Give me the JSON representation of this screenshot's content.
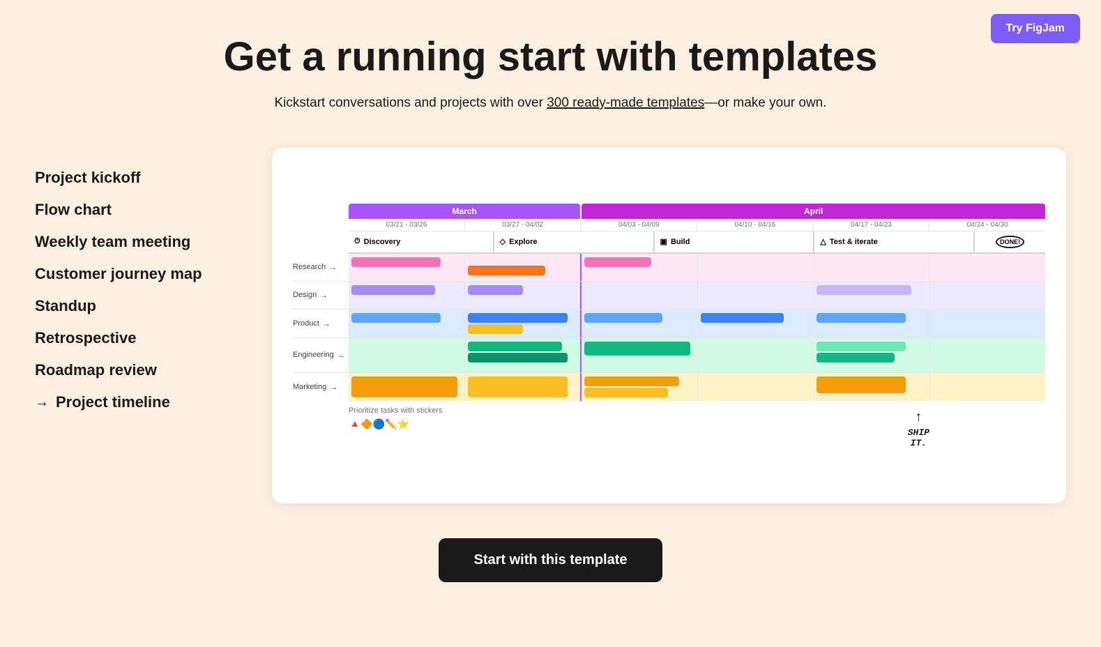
{
  "header": {
    "title": "Get a running start with templates",
    "subtitle_plain": "Kickstart conversations and projects with over ",
    "subtitle_link": "300 ready-made templates",
    "subtitle_end": "—or make your own.",
    "try_button": "Try FigJam"
  },
  "sidebar": {
    "items": [
      {
        "id": "project-kickoff",
        "label": "Project kickoff",
        "active": false,
        "arrow": false
      },
      {
        "id": "flow-chart",
        "label": "Flow chart",
        "active": false,
        "arrow": false
      },
      {
        "id": "weekly-team-meeting",
        "label": "Weekly team meeting",
        "active": false,
        "arrow": false
      },
      {
        "id": "customer-journey-map",
        "label": "Customer journey map",
        "active": false,
        "arrow": false
      },
      {
        "id": "standup",
        "label": "Standup",
        "active": false,
        "arrow": false
      },
      {
        "id": "retrospective",
        "label": "Retrospective",
        "active": false,
        "arrow": false
      },
      {
        "id": "roadmap-review",
        "label": "Roadmap review",
        "active": false,
        "arrow": false
      },
      {
        "id": "project-timeline",
        "label": "Project timeline",
        "active": true,
        "arrow": true
      }
    ]
  },
  "timeline": {
    "months": [
      {
        "label": "March",
        "color": "#a855f7"
      },
      {
        "label": "April",
        "color": "#c026d3"
      }
    ],
    "weeks": [
      "03/21 - 03/26",
      "03/27 - 04/02",
      "04/03 - 04/09",
      "04/10 - 04/16",
      "04/17 - 04/23",
      "04/24 - 04/30"
    ],
    "phases": [
      {
        "icon": "⏱",
        "label": "Discovery"
      },
      {
        "icon": "◇",
        "label": "Explore"
      },
      {
        "icon": "▣",
        "label": "Build"
      },
      {
        "icon": "△",
        "label": "Test & iterate"
      },
      {
        "label": "DONE!",
        "badge": true
      }
    ],
    "rows": [
      {
        "label": "Research",
        "color": "#fce7f3"
      },
      {
        "label": "Design",
        "color": "#ede9fe"
      },
      {
        "label": "Product",
        "color": "#dbeafe"
      },
      {
        "label": "Engineering",
        "color": "#d1fae5"
      },
      {
        "label": "Marketing",
        "color": "#fef3c7"
      }
    ],
    "prioritize_text": "Prioritize tasks with stickers",
    "emojis": "🔺🔶🔵✏️⭐",
    "ship_it": "SHIP\nIT.",
    "ship_arrow": "↑"
  },
  "cta": {
    "button_label": "Start with this template"
  }
}
